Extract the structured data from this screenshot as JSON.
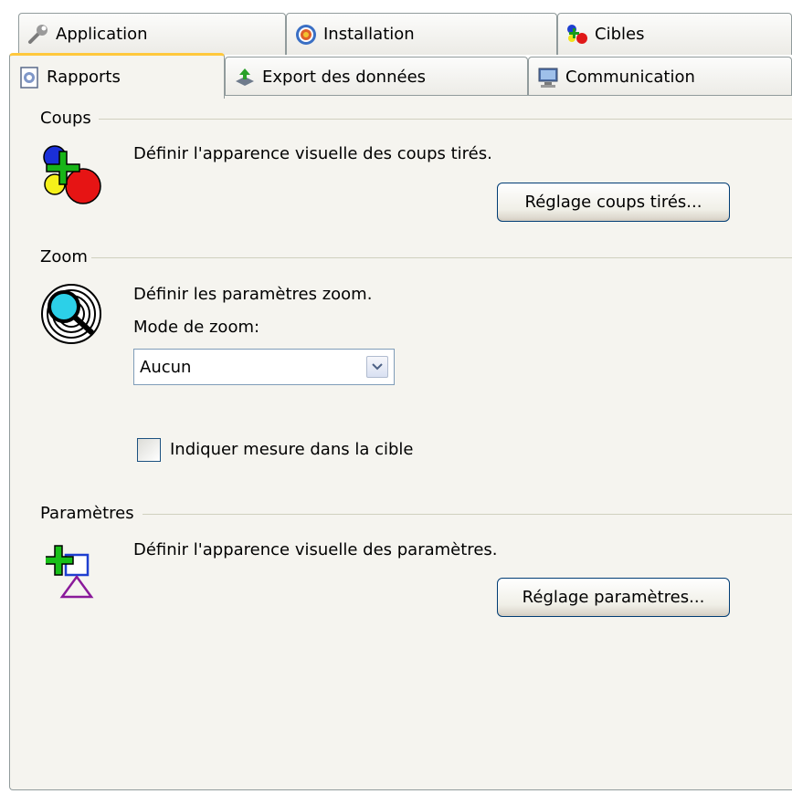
{
  "tabs_row1": [
    {
      "label": "Application",
      "icon": "wrench-icon"
    },
    {
      "label": "Installation",
      "icon": "target-icon"
    },
    {
      "label": "Cibles",
      "icon": "targets-icon"
    }
  ],
  "tabs_row2": [
    {
      "label": "Rapports",
      "icon": "report-icon",
      "active": true
    },
    {
      "label": "Export des données",
      "icon": "export-icon"
    },
    {
      "label": "Communication",
      "icon": "computer-icon"
    }
  ],
  "coups": {
    "title": "Coups",
    "description": "Définir l'apparence visuelle des coups tirés.",
    "button_label": "Réglage coups tirés..."
  },
  "zoom": {
    "title": "Zoom",
    "description": "Définir les paramètres zoom.",
    "mode_label": "Mode de zoom:",
    "mode_value": "Aucun",
    "checkbox_label": "Indiquer mesure dans la cible",
    "checkbox_checked": false
  },
  "parametres": {
    "title": "Paramètres",
    "description": "Définir l'apparence visuelle des paramètres.",
    "button_label": "Réglage paramètres..."
  }
}
